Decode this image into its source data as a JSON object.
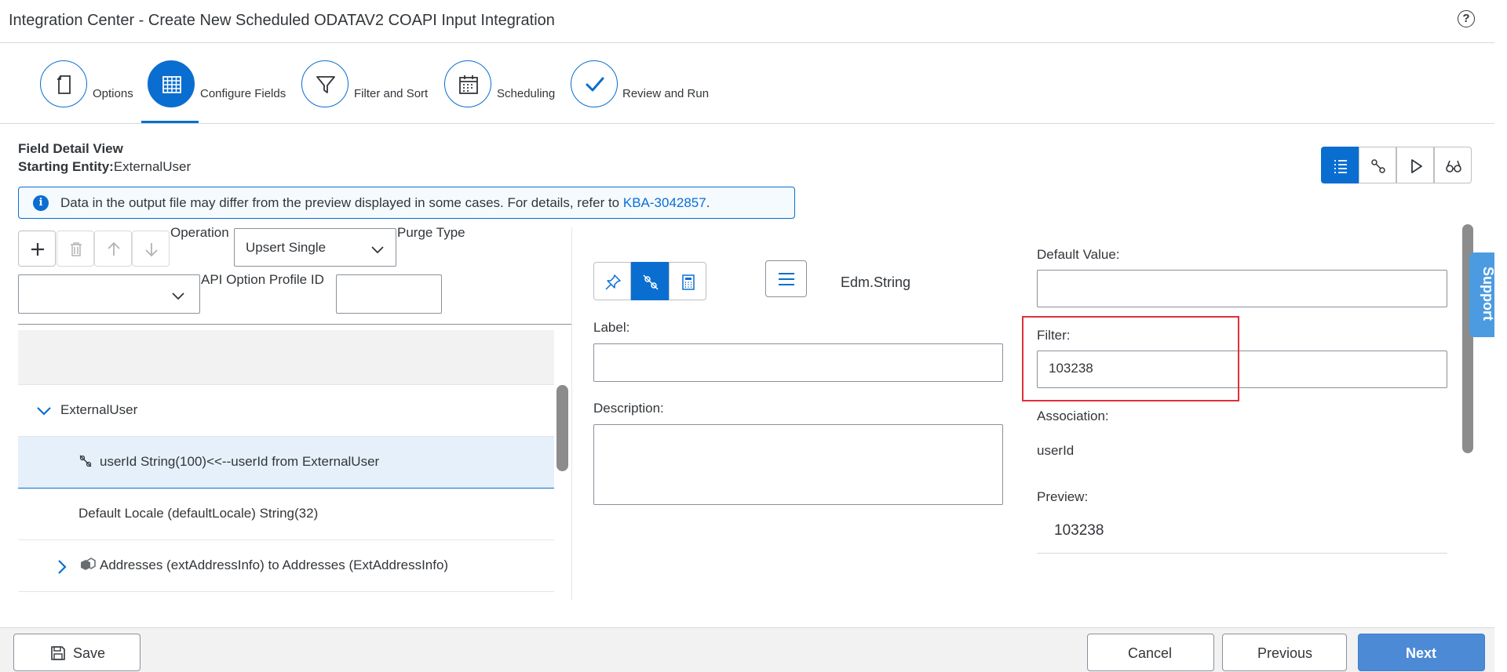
{
  "app": {
    "title": "Integration Center - Create New Scheduled ODATAV2 COAPI Input Integration",
    "help_icon": "?"
  },
  "wizard": {
    "steps": [
      {
        "label": "Options",
        "icon": "document-icon",
        "active": false
      },
      {
        "label": "Configure Fields",
        "icon": "grid-table-icon",
        "active": true
      },
      {
        "label": "Filter and Sort",
        "icon": "funnel-icon",
        "active": false
      },
      {
        "label": "Scheduling",
        "icon": "calendar-icon",
        "active": false
      },
      {
        "label": "Review and Run",
        "icon": "checkmark-icon",
        "active": false
      }
    ]
  },
  "detail": {
    "section_title": "Field Detail View",
    "entity_label": "Starting Entity:",
    "entity_value": "ExternalUser",
    "info_text": "Data in the output file may differ from the preview displayed in some cases. For details, refer to ",
    "info_link": "KBA-3042857",
    "info_suffix": "."
  },
  "view_buttons": [
    "list-view-icon",
    "mapping-view-icon",
    "play-icon",
    "glasses-icon"
  ],
  "toolbar": {
    "operation_label": "Operation",
    "operation_value": "Upsert Single",
    "purge_type_label": "Purge Type",
    "purge_type_value": "",
    "api_option_label": "API Option Profile ID",
    "api_option_value": ""
  },
  "tree": {
    "rows": [
      {
        "text": "ExternalUser",
        "icon": "chevron-down-icon",
        "selected": false
      },
      {
        "text": "userId String(100)<<--userId from ExternalUser",
        "icon": "unlink-icon",
        "selected": true
      },
      {
        "text": "Default Locale (defaultLocale) String(32)",
        "icon": "",
        "selected": false
      },
      {
        "text": "Addresses (extAddressInfo) to Addresses (ExtAddressInfo)",
        "icon": "cubes-icon",
        "selected": false
      }
    ]
  },
  "field": {
    "mode_buttons": [
      "pin-icon",
      "unlink-icon",
      "calculator-icon"
    ],
    "type": "Edm.String",
    "label_label": "Label:",
    "label_value": "",
    "description_label": "Description:",
    "description_value": "",
    "default_value_label": "Default Value:",
    "default_value": "",
    "filter_label": "Filter:",
    "filter_value": "103238",
    "association_label": "Association:",
    "association_value": "userId",
    "preview_label": "Preview:",
    "preview_value": "103238"
  },
  "support": {
    "label": "Support"
  },
  "footer": {
    "save": "Save",
    "cancel": "Cancel",
    "previous": "Previous",
    "next": "Next"
  },
  "colors": {
    "accent": "#0a6ed1",
    "highlight": "#e0303a",
    "next_button": "#4c8ad6"
  }
}
